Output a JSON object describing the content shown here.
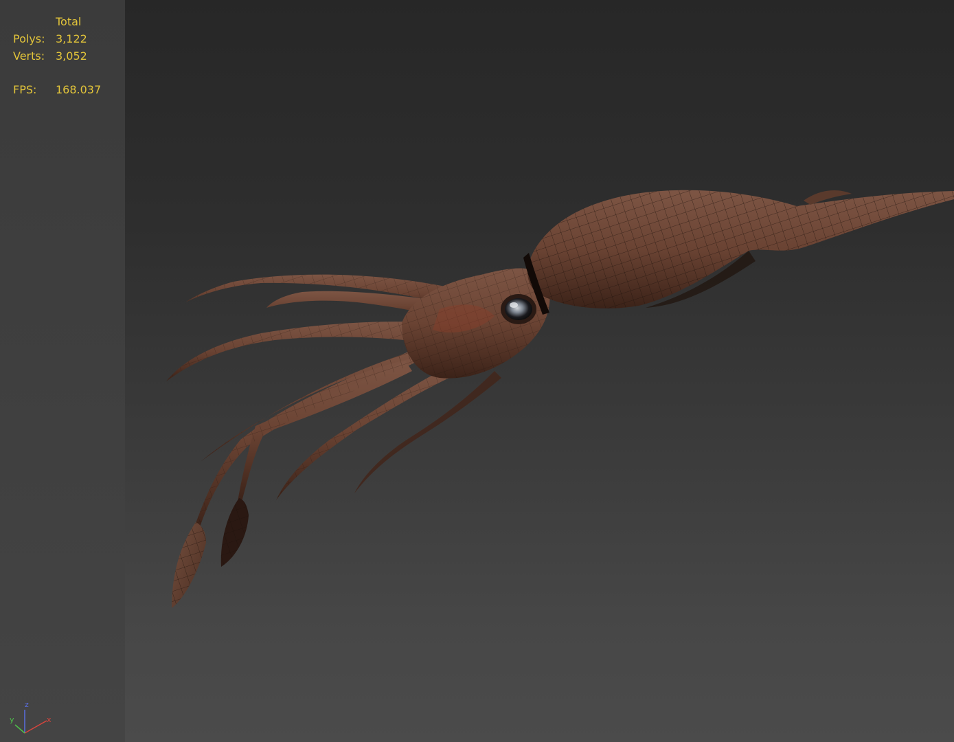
{
  "stats": {
    "total_header": "Total",
    "polys_label": "Polys:",
    "polys_value": "3,122",
    "verts_label": "Verts:",
    "verts_value": "3,052",
    "fps_label": "FPS:",
    "fps_value": "168.037"
  },
  "axis": {
    "x": "x",
    "y": "y",
    "z": "z"
  },
  "colors": {
    "stat_text": "#e2c43a",
    "axis_x": "#d9453d",
    "axis_y": "#4fc04a",
    "axis_z": "#5a6ee0",
    "squid_skin": "#6b4535"
  },
  "viewport_content": {
    "model_icon": "squid-wireframe-model"
  }
}
